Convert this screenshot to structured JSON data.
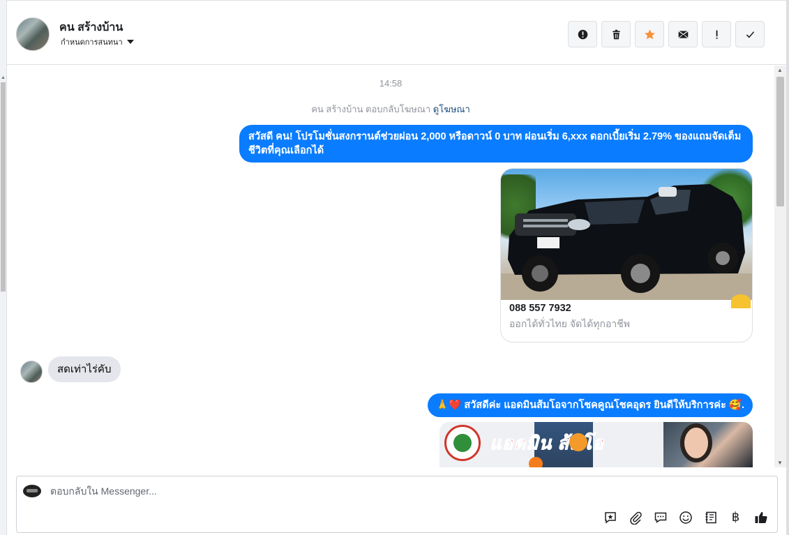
{
  "header": {
    "contact_name": "คน สร้างบ้าน",
    "assign_label": "กำหนดการสนทนา"
  },
  "chat": {
    "timestamp": "14:58",
    "system_prefix": "คน สร้างบ้าน ตอบกลับโฆษณา",
    "system_link": "ดูโฆษณา",
    "msg1": "สวัสดี คน! โปรโมชั่นสงกรานต์ช่วยผ่อน 2,000 หรือดาวน์ 0 บาท ผ่อนเริ่ม 6,xxx ดอกเบี้ยเริ่ม 2.79% ของแถมจัดเต็ม ชีวิตที่คุณเลือกได้",
    "card_phone": "088 557 7932",
    "card_desc": "ออกได้ทั่วไทย จัดได้ทุกอาชีพ",
    "incoming_msg": "สดเท่าไร่คับ",
    "msg3": "🙏❤️ สวัสดีค่ะ แอดมินส้มโอจากโชคคูณโชคอุดร ยินดีให้บริการค่ะ 🥰.",
    "banner_title": "แอดมิน    ส้มโอ"
  },
  "composer": {
    "placeholder": "ตอบกลับใน Messenger...",
    "baht_symbol": "฿"
  },
  "icons": {
    "actions": [
      "alert-circle-icon",
      "trash-icon",
      "star-icon",
      "envelope-icon",
      "exclamation-icon",
      "check-icon"
    ],
    "tools": [
      "saved-reply-icon",
      "paperclip-icon",
      "chat-bubble-icon",
      "emoji-icon",
      "notes-icon",
      "baht-icon",
      "thumbs-up-icon"
    ]
  },
  "colors": {
    "outgoing_bubble": "#0a7cff",
    "incoming_bubble": "#e4e6eb",
    "star": "#f7923b"
  }
}
